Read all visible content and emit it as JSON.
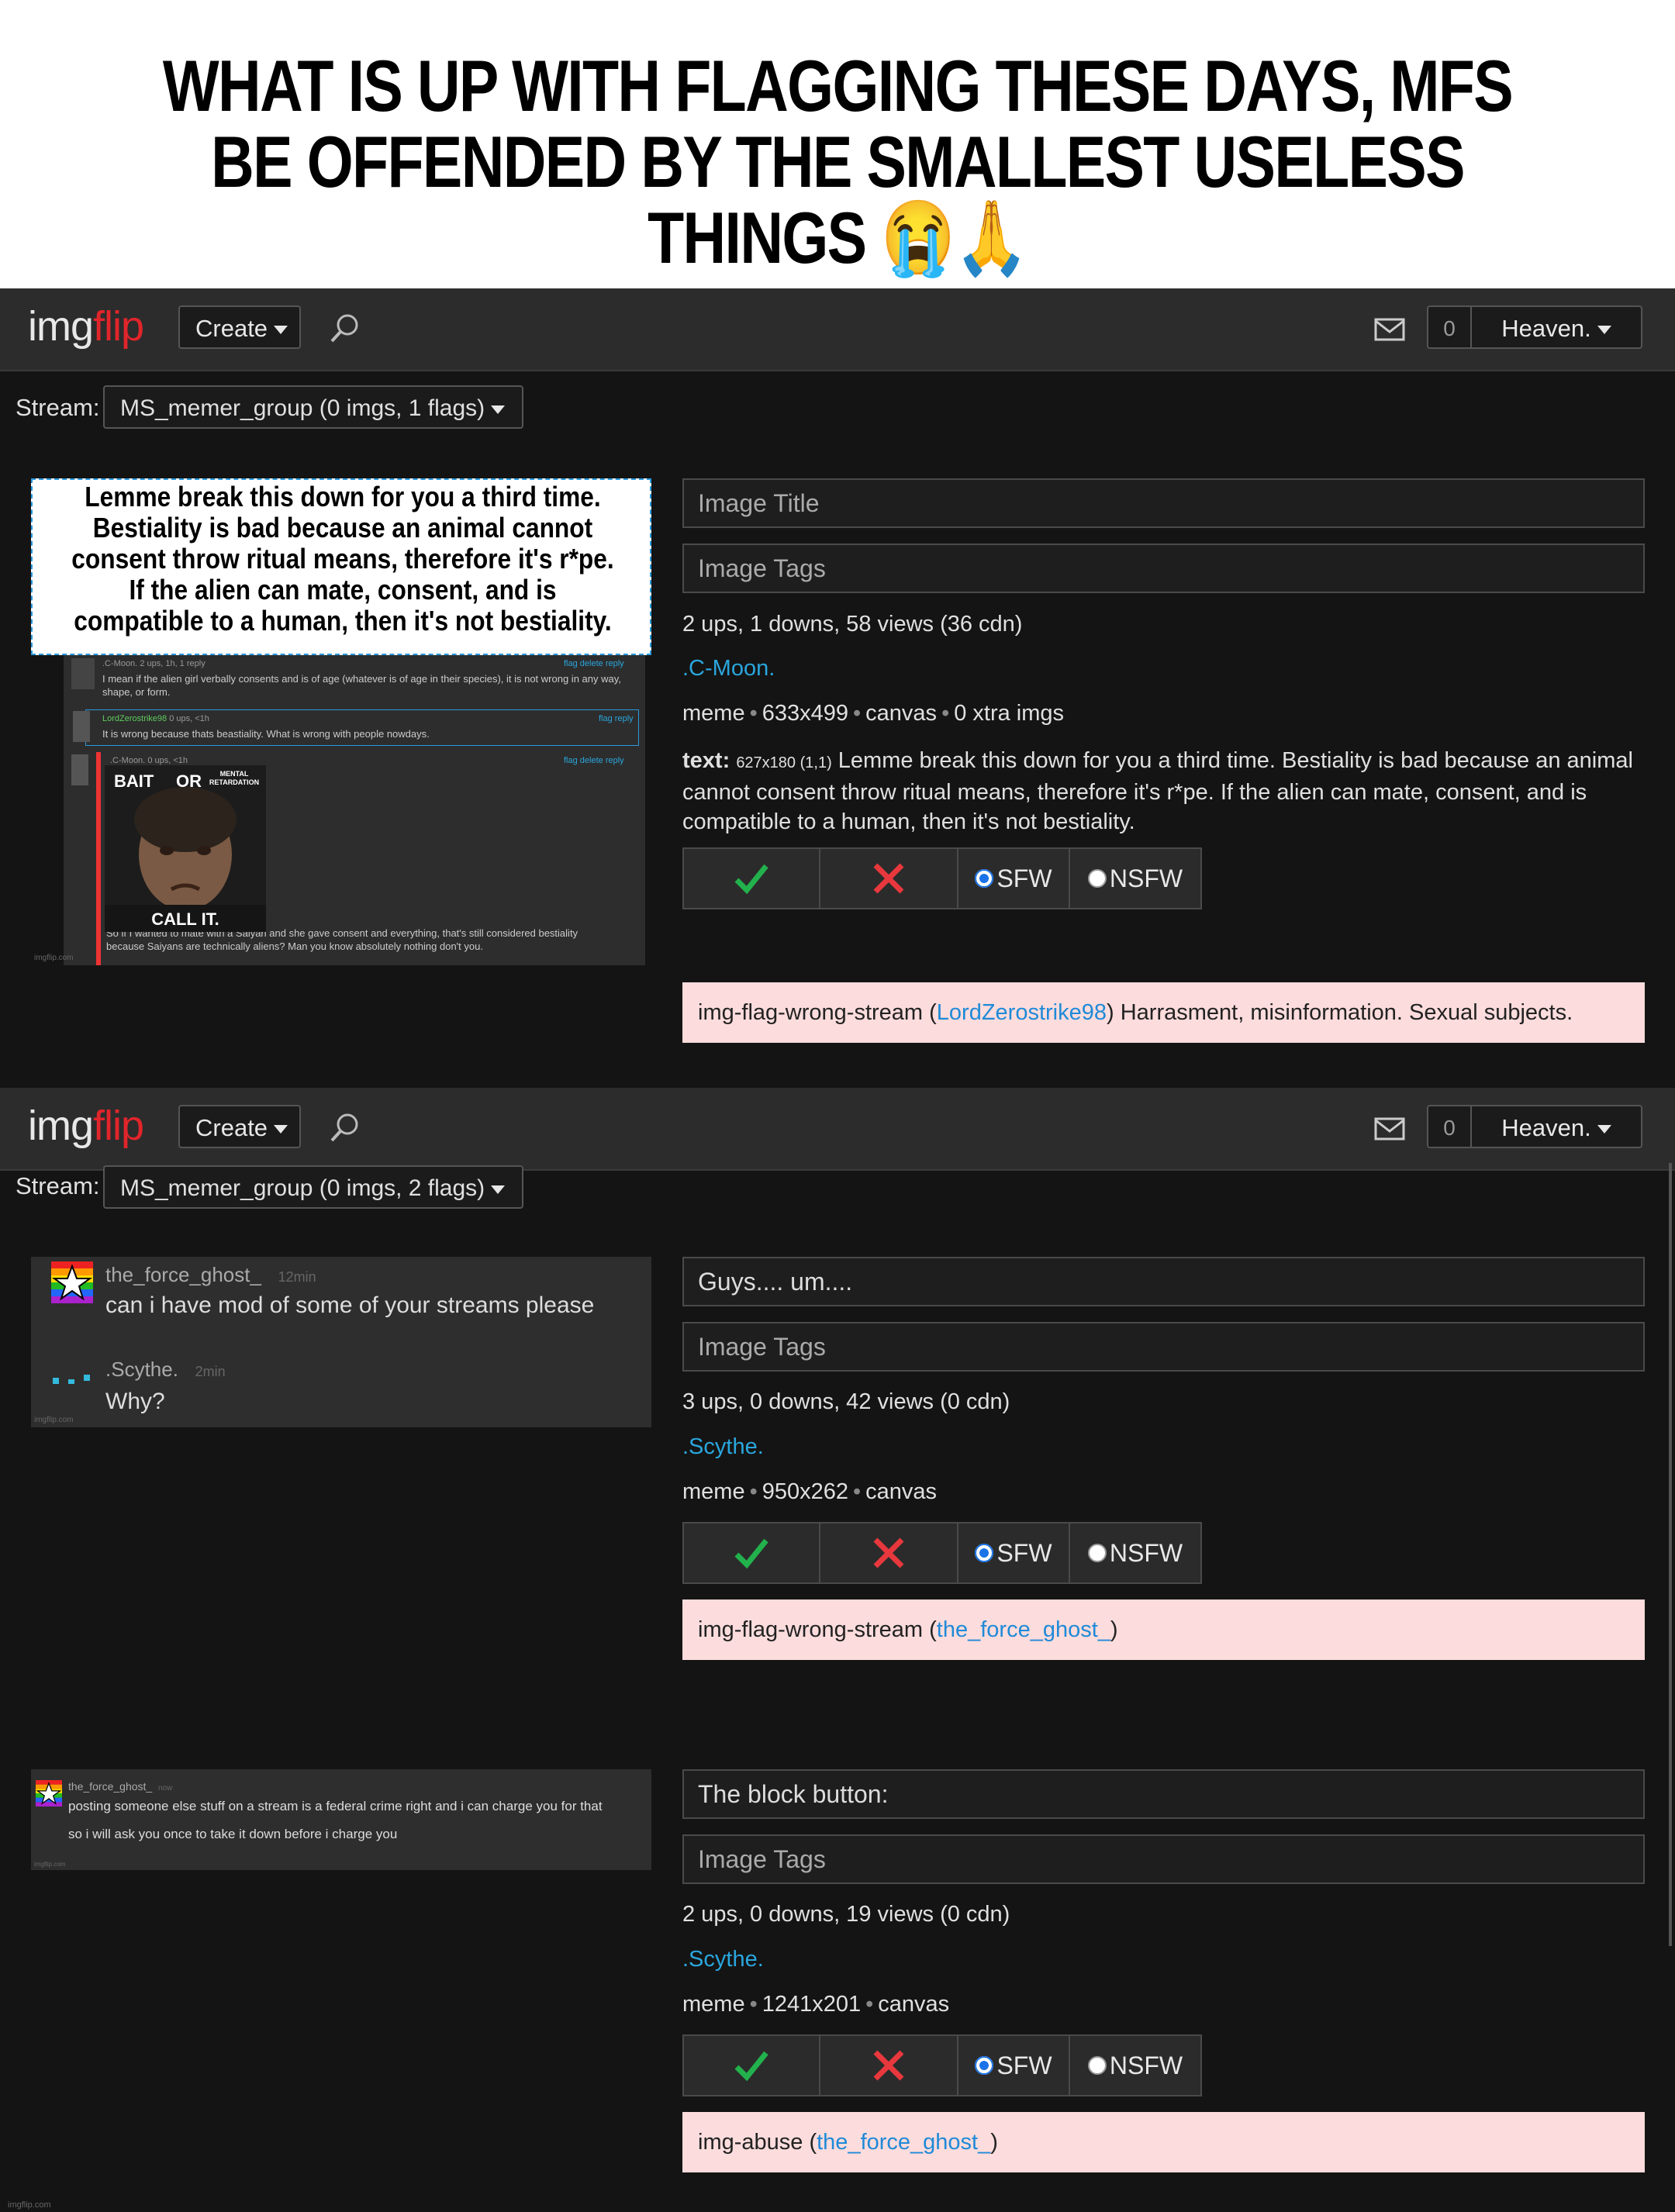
{
  "caption": "WHAT IS UP WITH FLAGGING THESE DAYS, MFS BE OFFENDED BY THE SMALLEST USELESS THINGS 😭🙏",
  "colors": {
    "accent_link": "#2aa6dd",
    "flag_bg": "#fcdcdc",
    "logo_red": "#e0252b",
    "check_green": "#22b14c",
    "cross_red": "#e8383d"
  },
  "nav": {
    "logo_a": "img",
    "logo_b": "flip",
    "create": "Create",
    "search_icon": "search-icon",
    "mail_icon": "mail-icon",
    "count": "0",
    "user": "Heaven."
  },
  "stream_label": "Stream:",
  "panels": [
    {
      "stream": "MS_memer_group (0 imgs, 1 flags)",
      "title_placeholder": "Image Title",
      "tags_placeholder": "Image Tags",
      "stats": "2 ups, 1 downs, 58 views (36 cdn)",
      "author": ".C-Moon.",
      "meta_a": "meme",
      "meta_b": "633x499",
      "meta_c": "canvas",
      "meta_d": "0 xtra imgs",
      "text_label": "text",
      "text_dims": "627x180 (1,1)",
      "text_body": "Lemme break this down for you a third time. Bestiality is bad because an animal cannot consent throw ritual means, therefore it's r*pe. If the alien can mate, consent, and is compatible to a human, then it's not bestiality.",
      "sfw": "SFW",
      "nsfw": "NSFW",
      "flag_type": "img-flag-wrong-stream",
      "flag_user": "LordZerostrike98",
      "flag_reason": "Harrasment, misinformation. Sexual subjects.",
      "thumb": {
        "card_text": "Lemme break this down for you a third time. Bestiality is bad because an animal cannot consent throw ritual means, therefore it's r*pe. If the alien can mate, consent, and is compatible to a human, then it's not bestiality.",
        "c1_user": ".C-Moon.",
        "c1_meta": "2 ups, 1h, 1 reply",
        "c1_actions": "flag delete reply",
        "c1_text": "I mean if the alien girl verbally consents and is of age (whatever is of age in their species), it is not wrong in any way, shape, or form.",
        "c2_user": "LordZerostrike98",
        "c2_meta": "0 ups, <1h",
        "c2_actions": "flag reply",
        "c2_text": "It is wrong because thats beastiality. What is wrong with people nowdays.",
        "c3_user": ".C-Moon.",
        "c3_meta": "0 ups, <1h",
        "c3_actions": "flag delete reply",
        "meme_bait": "BAIT",
        "meme_or": "OR",
        "meme_mental": "MENTAL RETARDATION",
        "meme_callit": "CALL IT.",
        "c3_text": "So if I wanted to mate with a Saiyan and she gave consent and everything, that's still considered bestiality because Saiyans are technically aliens? Man you know absolutely nothing don't you.",
        "watermark": "imgflip.com"
      }
    },
    {
      "stream": "MS_memer_group (0 imgs, 2 flags)",
      "title_value": "Guys.... um....",
      "tags_placeholder": "Image Tags",
      "stats": "3 ups, 0 downs, 42 views (0 cdn)",
      "author": ".Scythe.",
      "meta_a": "meme",
      "meta_b": "950x262",
      "meta_c": "canvas",
      "sfw": "SFW",
      "nsfw": "NSFW",
      "flag_type": "img-flag-wrong-stream",
      "flag_user": "the_force_ghost_",
      "thumb": {
        "u1": "the_force_ghost_",
        "t1": "12min",
        "m1": "can i have mod of some of your streams please",
        "u2": ".Scythe.",
        "t2": "2min",
        "m2": "Why?",
        "watermark": "imgflip.com"
      }
    },
    {
      "title_value": "The block button:",
      "tags_placeholder": "Image Tags",
      "stats": "2 ups, 0 downs, 19 views (0 cdn)",
      "author": ".Scythe.",
      "meta_a": "meme",
      "meta_b": "1241x201",
      "meta_c": "canvas",
      "sfw": "SFW",
      "nsfw": "NSFW",
      "flag_type": "img-abuse",
      "flag_user": "the_force_ghost_",
      "thumb": {
        "u1": "the_force_ghost_",
        "t1": "now",
        "m1": "posting someone else stuff on a stream is a federal crime right and i can charge you for that",
        "m2": "so i will ask you once to take it down before i charge you",
        "watermark": "imgflip.com"
      }
    }
  ],
  "footer_watermark": "imgflip.com"
}
